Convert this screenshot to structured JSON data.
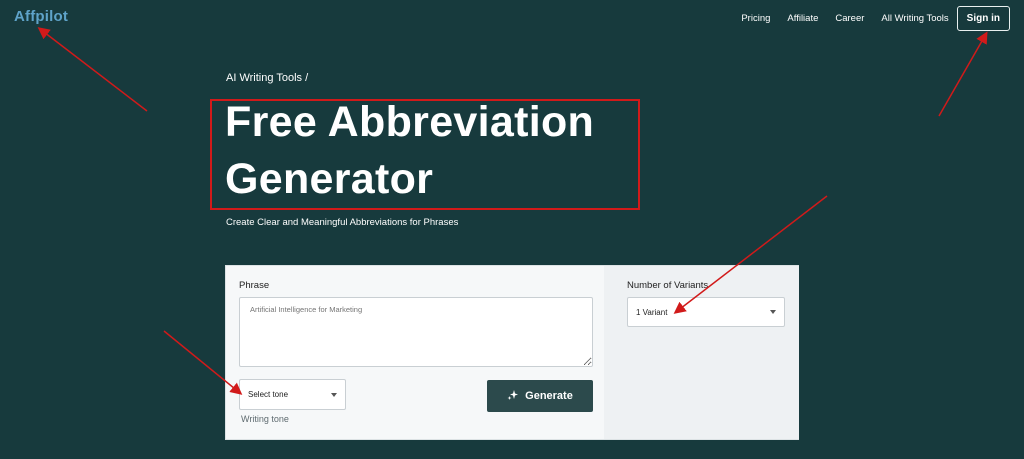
{
  "header": {
    "logo": "Affpilot",
    "nav": [
      "Pricing",
      "Affiliate",
      "Career",
      "All Writing Tools"
    ],
    "signin_label": "Sign in"
  },
  "hero": {
    "breadcrumb": "AI Writing Tools /",
    "title_line1": "Free Abbreviation",
    "title_line2": "Generator",
    "subtitle": "Create Clear and Meaningful Abbreviations for Phrases"
  },
  "form": {
    "phrase_label": "Phrase",
    "phrase_placeholder": "Artificial Intelligence for Marketing",
    "tone_value": "Select tone",
    "tone_helper": "Writing tone",
    "generate_label": "Generate",
    "variants_label": "Number of Variants",
    "variants_value": "1 Variant"
  },
  "colors": {
    "background": "#173a3d",
    "logo": "#5fa3c9",
    "button": "#2c4a4c",
    "annotation": "#d11a1a"
  }
}
